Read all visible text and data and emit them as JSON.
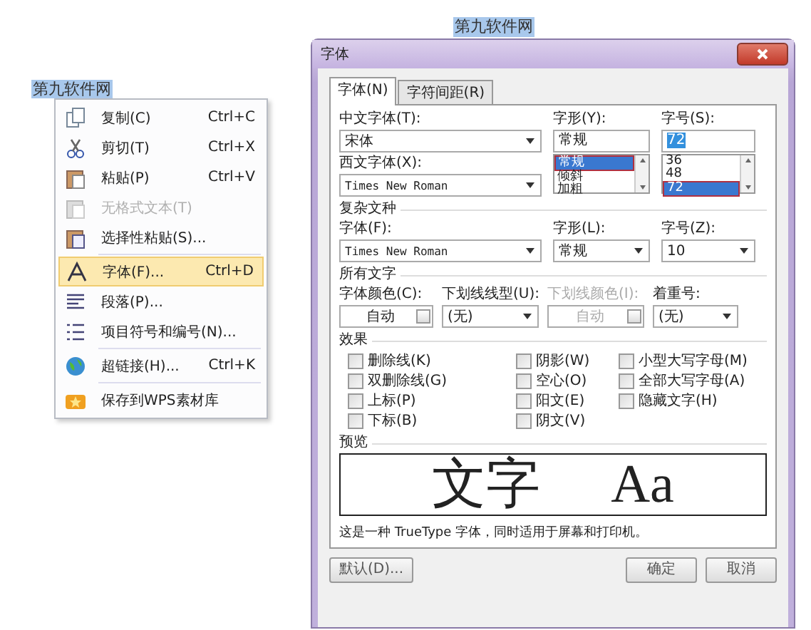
{
  "page_label": {
    "text": "第九软件网",
    "selected": true
  },
  "document": {
    "text": "第九软件网",
    "selected": true
  },
  "context_menu": {
    "items": [
      {
        "kind": "item",
        "label": "复制(C)",
        "shortcut": "Ctrl+C",
        "disabled": false,
        "selected": false
      },
      {
        "kind": "item",
        "label": "剪切(T)",
        "shortcut": "Ctrl+X",
        "disabled": false,
        "selected": false
      },
      {
        "kind": "item",
        "label": "粘贴(P)",
        "shortcut": "Ctrl+V",
        "disabled": false,
        "selected": false
      },
      {
        "kind": "item",
        "label": "无格式文本(T)",
        "disabled": true,
        "selected": false
      },
      {
        "kind": "item",
        "label": "选择性粘贴(S)...",
        "disabled": false,
        "selected": false
      },
      {
        "kind": "separator"
      },
      {
        "kind": "item",
        "label": "字体(F)...",
        "shortcut": "Ctrl+D",
        "disabled": false,
        "selected": true
      },
      {
        "kind": "item",
        "label": "段落(P)...",
        "disabled": false,
        "selected": false
      },
      {
        "kind": "item",
        "label": "项目符号和编号(N)...",
        "disabled": false,
        "selected": false
      },
      {
        "kind": "separator"
      },
      {
        "kind": "item",
        "label": "超链接(H)...",
        "shortcut": "Ctrl+K",
        "disabled": false,
        "selected": false
      },
      {
        "kind": "separator"
      },
      {
        "kind": "item",
        "label": "保存到WPS素材库",
        "disabled": false,
        "selected": false
      }
    ]
  },
  "dialog": {
    "title": "字体",
    "tabs": [
      {
        "label": "字体(N)",
        "selected": true
      },
      {
        "label": "字符间距(R)",
        "selected": false
      }
    ],
    "chinese_font": {
      "label": "中文字体(T):",
      "value": "宋体"
    },
    "style": {
      "label": "字形(Y):",
      "value": "常规",
      "options": [
        {
          "label": "常规",
          "selected": true
        },
        {
          "label": "倾斜",
          "selected": false
        },
        {
          "label": "加粗",
          "selected": false
        }
      ]
    },
    "size": {
      "label": "字号(S):",
      "value": "72",
      "options": [
        {
          "label": "36",
          "selected": false
        },
        {
          "label": "48",
          "selected": false
        },
        {
          "label": "72",
          "selected": true
        }
      ]
    },
    "western_font": {
      "label": "西文字体(X):",
      "value": "Times New Roman"
    },
    "complex_script": {
      "heading": "复杂文种",
      "font": {
        "label": "字体(F):",
        "value": "Times New Roman"
      },
      "style": {
        "label": "字形(L):",
        "value": "常规"
      },
      "size": {
        "label": "字号(Z):",
        "value": "10"
      }
    },
    "all_text": {
      "heading": "所有文字",
      "controls": [
        {
          "kind": "color",
          "label": "字体颜色(C):",
          "value": "自动",
          "disabled": false
        },
        {
          "kind": "select",
          "label": "下划线线型(U):",
          "value": "(无)",
          "disabled": false
        },
        {
          "kind": "color",
          "label": "下划线颜色(I):",
          "value": "自动",
          "disabled": true
        },
        {
          "kind": "select",
          "label": "着重号:",
          "value": "(无)",
          "disabled": false
        }
      ]
    },
    "effects": {
      "heading": "效果",
      "options": [
        {
          "label": "删除线(K)",
          "checked": false
        },
        {
          "label": "双删除线(G)",
          "checked": false
        },
        {
          "label": "上标(P)",
          "checked": false
        },
        {
          "label": "下标(B)",
          "checked": false
        },
        {
          "label": "阴影(W)",
          "checked": false
        },
        {
          "label": "空心(O)",
          "checked": false
        },
        {
          "label": "阳文(E)",
          "checked": false
        },
        {
          "label": "阴文(V)",
          "checked": false
        },
        {
          "label": "小型大写字母(M)",
          "checked": false
        },
        {
          "label": "全部大写字母(A)",
          "checked": false
        },
        {
          "label": "隐藏文字(H)",
          "checked": false
        }
      ]
    },
    "preview": {
      "heading": "预览",
      "sample": "文字 Aa",
      "description": "这是一种 TrueType 字体，同时适用于屏幕和打印机。"
    },
    "buttons": [
      {
        "label": "默认(D)..."
      },
      {
        "label": "确定"
      },
      {
        "label": "取消"
      }
    ]
  }
}
